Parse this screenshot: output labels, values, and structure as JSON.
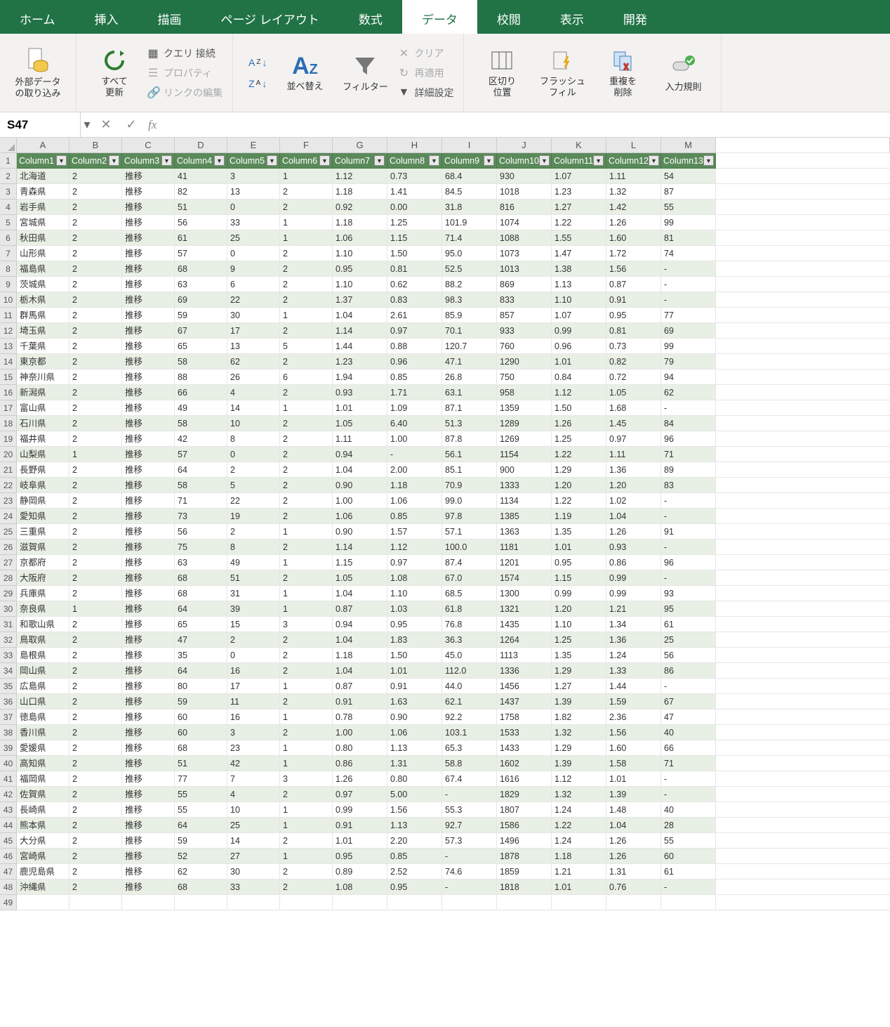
{
  "tabs": [
    "ホーム",
    "挿入",
    "描画",
    "ページ レイアウト",
    "数式",
    "データ",
    "校閲",
    "表示",
    "開発"
  ],
  "active_tab_index": 5,
  "ribbon": {
    "external": "外部データ\nの取り込み",
    "refresh": "すべて\n更新",
    "query": "クエリ 接続",
    "props": "プロパティ",
    "links": "リンクの編集",
    "sort": "並べ替え",
    "filter": "フィルター",
    "clear": "クリア",
    "reapply": "再適用",
    "advanced": "詳細設定",
    "text2col": "区切り\n位置",
    "flash": "フラッシュ\nフィル",
    "dedupe": "重複を\n削除",
    "validate": "入力規則"
  },
  "name_box": "S47",
  "cols": [
    "A",
    "B",
    "C",
    "D",
    "E",
    "F",
    "G",
    "H",
    "I",
    "J",
    "K",
    "L",
    "M"
  ],
  "headers": [
    "Column1",
    "Column2",
    "Column3",
    "Column4",
    "Column5",
    "Column6",
    "Column7",
    "Column8",
    "Column9",
    "Column10",
    "Column11",
    "Column12",
    "Column13"
  ],
  "row_numbers": [
    1,
    2,
    3,
    4,
    5,
    6,
    7,
    8,
    9,
    10,
    11,
    12,
    13,
    14,
    15,
    16,
    17,
    18,
    19,
    20,
    21,
    22,
    23,
    24,
    25,
    26,
    27,
    28,
    29,
    30,
    31,
    32,
    33,
    34,
    35,
    36,
    37,
    38,
    39,
    40,
    41,
    42,
    43,
    44,
    45,
    46,
    47,
    48,
    49
  ],
  "rows": [
    [
      "北海道",
      "2",
      "推移",
      "41",
      "3",
      "1",
      "1.12",
      "0.73",
      "68.4",
      "930",
      "1.07",
      "1.11",
      "54"
    ],
    [
      "青森県",
      "2",
      "推移",
      "82",
      "13",
      "2",
      "1.18",
      "1.41",
      "84.5",
      "1018",
      "1.23",
      "1.32",
      "87"
    ],
    [
      "岩手県",
      "2",
      "推移",
      "51",
      "0",
      "2",
      "0.92",
      "0.00",
      "31.8",
      "816",
      "1.27",
      "1.42",
      "55"
    ],
    [
      "宮城県",
      "2",
      "推移",
      "56",
      "33",
      "1",
      "1.18",
      "1.25",
      "101.9",
      "1074",
      "1.22",
      "1.26",
      "99"
    ],
    [
      "秋田県",
      "2",
      "推移",
      "61",
      "25",
      "1",
      "1.06",
      "1.15",
      "71.4",
      "1088",
      "1.55",
      "1.60",
      "81"
    ],
    [
      "山形県",
      "2",
      "推移",
      "57",
      "0",
      "2",
      "1.10",
      "1.50",
      "95.0",
      "1073",
      "1.47",
      "1.72",
      "74"
    ],
    [
      "福島県",
      "2",
      "推移",
      "68",
      "9",
      "2",
      "0.95",
      "0.81",
      "52.5",
      "1013",
      "1.38",
      "1.56",
      "-"
    ],
    [
      "茨城県",
      "2",
      "推移",
      "63",
      "6",
      "2",
      "1.10",
      "0.62",
      "88.2",
      "869",
      "1.13",
      "0.87",
      "-"
    ],
    [
      "栃木県",
      "2",
      "推移",
      "69",
      "22",
      "2",
      "1.37",
      "0.83",
      "98.3",
      "833",
      "1.10",
      "0.91",
      "-"
    ],
    [
      "群馬県",
      "2",
      "推移",
      "59",
      "30",
      "1",
      "1.04",
      "2.61",
      "85.9",
      "857",
      "1.07",
      "0.95",
      "77"
    ],
    [
      "埼玉県",
      "2",
      "推移",
      "67",
      "17",
      "2",
      "1.14",
      "0.97",
      "70.1",
      "933",
      "0.99",
      "0.81",
      "69"
    ],
    [
      "千葉県",
      "2",
      "推移",
      "65",
      "13",
      "5",
      "1.44",
      "0.88",
      "120.7",
      "760",
      "0.96",
      "0.73",
      "99"
    ],
    [
      "東京都",
      "2",
      "推移",
      "58",
      "62",
      "2",
      "1.23",
      "0.96",
      "47.1",
      "1290",
      "1.01",
      "0.82",
      "79"
    ],
    [
      "神奈川県",
      "2",
      "推移",
      "88",
      "26",
      "6",
      "1.94",
      "0.85",
      "26.8",
      "750",
      "0.84",
      "0.72",
      "94"
    ],
    [
      "新潟県",
      "2",
      "推移",
      "66",
      "4",
      "2",
      "0.93",
      "1.71",
      "63.1",
      "958",
      "1.12",
      "1.05",
      "62"
    ],
    [
      "富山県",
      "2",
      "推移",
      "49",
      "14",
      "1",
      "1.01",
      "1.09",
      "87.1",
      "1359",
      "1.50",
      "1.68",
      "-"
    ],
    [
      "石川県",
      "2",
      "推移",
      "58",
      "10",
      "2",
      "1.05",
      "6.40",
      "51.3",
      "1289",
      "1.26",
      "1.45",
      "84"
    ],
    [
      "福井県",
      "2",
      "推移",
      "42",
      "8",
      "2",
      "1.11",
      "1.00",
      "87.8",
      "1269",
      "1.25",
      "0.97",
      "96"
    ],
    [
      "山梨県",
      "1",
      "推移",
      "57",
      "0",
      "2",
      "0.94",
      "-",
      "56.1",
      "1154",
      "1.22",
      "1.11",
      "71"
    ],
    [
      "長野県",
      "2",
      "推移",
      "64",
      "2",
      "2",
      "1.04",
      "2.00",
      "85.1",
      "900",
      "1.29",
      "1.36",
      "89"
    ],
    [
      "岐阜県",
      "2",
      "推移",
      "58",
      "5",
      "2",
      "0.90",
      "1.18",
      "70.9",
      "1333",
      "1.20",
      "1.20",
      "83"
    ],
    [
      "静岡県",
      "2",
      "推移",
      "71",
      "22",
      "2",
      "1.00",
      "1.06",
      "99.0",
      "1134",
      "1.22",
      "1.02",
      "-"
    ],
    [
      "愛知県",
      "2",
      "推移",
      "73",
      "19",
      "2",
      "1.06",
      "0.85",
      "97.8",
      "1385",
      "1.19",
      "1.04",
      "-"
    ],
    [
      "三重県",
      "2",
      "推移",
      "56",
      "2",
      "1",
      "0.90",
      "1.57",
      "57.1",
      "1363",
      "1.35",
      "1.26",
      "91"
    ],
    [
      "滋賀県",
      "2",
      "推移",
      "75",
      "8",
      "2",
      "1.14",
      "1.12",
      "100.0",
      "1181",
      "1.01",
      "0.93",
      "-"
    ],
    [
      "京都府",
      "2",
      "推移",
      "63",
      "49",
      "1",
      "1.15",
      "0.97",
      "87.4",
      "1201",
      "0.95",
      "0.86",
      "96"
    ],
    [
      "大阪府",
      "2",
      "推移",
      "68",
      "51",
      "2",
      "1.05",
      "1.08",
      "67.0",
      "1574",
      "1.15",
      "0.99",
      "-"
    ],
    [
      "兵庫県",
      "2",
      "推移",
      "68",
      "31",
      "1",
      "1.04",
      "1.10",
      "68.5",
      "1300",
      "0.99",
      "0.99",
      "93"
    ],
    [
      "奈良県",
      "1",
      "推移",
      "64",
      "39",
      "1",
      "0.87",
      "1.03",
      "61.8",
      "1321",
      "1.20",
      "1.21",
      "95"
    ],
    [
      "和歌山県",
      "2",
      "推移",
      "65",
      "15",
      "3",
      "0.94",
      "0.95",
      "76.8",
      "1435",
      "1.10",
      "1.34",
      "61"
    ],
    [
      "鳥取県",
      "2",
      "推移",
      "47",
      "2",
      "2",
      "1.04",
      "1.83",
      "36.3",
      "1264",
      "1.25",
      "1.36",
      "25"
    ],
    [
      "島根県",
      "2",
      "推移",
      "35",
      "0",
      "2",
      "1.18",
      "1.50",
      "45.0",
      "1113",
      "1.35",
      "1.24",
      "56"
    ],
    [
      "岡山県",
      "2",
      "推移",
      "64",
      "16",
      "2",
      "1.04",
      "1.01",
      "112.0",
      "1336",
      "1.29",
      "1.33",
      "86"
    ],
    [
      "広島県",
      "2",
      "推移",
      "80",
      "17",
      "1",
      "0.87",
      "0.91",
      "44.0",
      "1456",
      "1.27",
      "1.44",
      "-"
    ],
    [
      "山口県",
      "2",
      "推移",
      "59",
      "11",
      "2",
      "0.91",
      "1.63",
      "62.1",
      "1437",
      "1.39",
      "1.59",
      "67"
    ],
    [
      "徳島県",
      "2",
      "推移",
      "60",
      "16",
      "1",
      "0.78",
      "0.90",
      "92.2",
      "1758",
      "1.82",
      "2.36",
      "47"
    ],
    [
      "香川県",
      "2",
      "推移",
      "60",
      "3",
      "2",
      "1.00",
      "1.06",
      "103.1",
      "1533",
      "1.32",
      "1.56",
      "40"
    ],
    [
      "愛媛県",
      "2",
      "推移",
      "68",
      "23",
      "1",
      "0.80",
      "1.13",
      "65.3",
      "1433",
      "1.29",
      "1.60",
      "66"
    ],
    [
      "高知県",
      "2",
      "推移",
      "51",
      "42",
      "1",
      "0.86",
      "1.31",
      "58.8",
      "1602",
      "1.39",
      "1.58",
      "71"
    ],
    [
      "福岡県",
      "2",
      "推移",
      "77",
      "7",
      "3",
      "1.26",
      "0.80",
      "67.4",
      "1616",
      "1.12",
      "1.01",
      "-"
    ],
    [
      "佐賀県",
      "2",
      "推移",
      "55",
      "4",
      "2",
      "0.97",
      "5.00",
      "-",
      "1829",
      "1.32",
      "1.39",
      "-"
    ],
    [
      "長崎県",
      "2",
      "推移",
      "55",
      "10",
      "1",
      "0.99",
      "1.56",
      "55.3",
      "1807",
      "1.24",
      "1.48",
      "40"
    ],
    [
      "熊本県",
      "2",
      "推移",
      "64",
      "25",
      "1",
      "0.91",
      "1.13",
      "92.7",
      "1586",
      "1.22",
      "1.04",
      "28"
    ],
    [
      "大分県",
      "2",
      "推移",
      "59",
      "14",
      "2",
      "1.01",
      "2.20",
      "57.3",
      "1496",
      "1.24",
      "1.26",
      "55"
    ],
    [
      "宮崎県",
      "2",
      "推移",
      "52",
      "27",
      "1",
      "0.95",
      "0.85",
      "-",
      "1878",
      "1.18",
      "1.26",
      "60"
    ],
    [
      "鹿児島県",
      "2",
      "推移",
      "62",
      "30",
      "2",
      "0.89",
      "2.52",
      "74.6",
      "1859",
      "1.21",
      "1.31",
      "61"
    ],
    [
      "沖縄県",
      "2",
      "推移",
      "68",
      "33",
      "2",
      "1.08",
      "0.95",
      "-",
      "1818",
      "1.01",
      "0.76",
      "-"
    ]
  ]
}
